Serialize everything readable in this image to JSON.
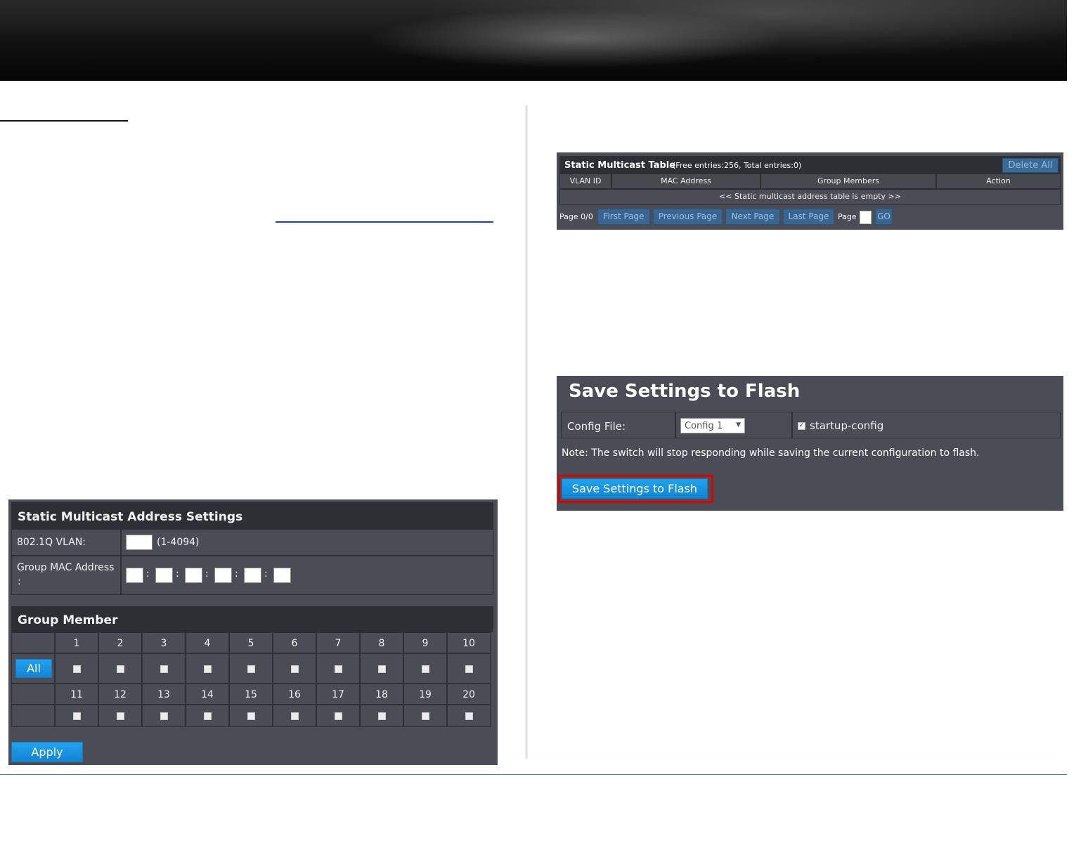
{
  "static_multicast_settings": {
    "title": "Static Multicast Address Settings",
    "vlan_label": "802.1Q VLAN:",
    "vlan_value": "",
    "vlan_range": "(1-4094)",
    "mac_label": "Group MAC Address",
    "mac_label_colon": ":",
    "mac_separator": ":",
    "group_member_title": "Group Member",
    "all_button": "All",
    "ports_row1": [
      "1",
      "2",
      "3",
      "4",
      "5",
      "6",
      "7",
      "8",
      "9",
      "10"
    ],
    "ports_row2": [
      "11",
      "12",
      "13",
      "14",
      "15",
      "16",
      "17",
      "18",
      "19",
      "20"
    ],
    "apply_button": "Apply"
  },
  "static_multicast_table": {
    "title": "Static Multicast Table",
    "entries_info": "(Free entries:256, Total entries:0)",
    "delete_all_button": "Delete All",
    "columns": [
      "VLAN ID",
      "MAC Address",
      "Group Members",
      "Action"
    ],
    "empty_message": "<< Static multicast address table is empty >>",
    "page_info": "Page 0/0",
    "first_page": "First Page",
    "previous_page": "Previous Page",
    "next_page": "Next Page",
    "last_page": "Last Page",
    "page_label": "Page",
    "go_button": "GO"
  },
  "save_flash": {
    "title": "Save Settings to Flash",
    "config_label": "Config File:",
    "config_selected": "Config 1",
    "startup_label": "startup-config",
    "startup_checked": true,
    "note": "Note: The switch will stop responding while saving the current configuration to flash.",
    "save_button": "Save Settings to Flash",
    "highlight_color": "#e00000"
  }
}
